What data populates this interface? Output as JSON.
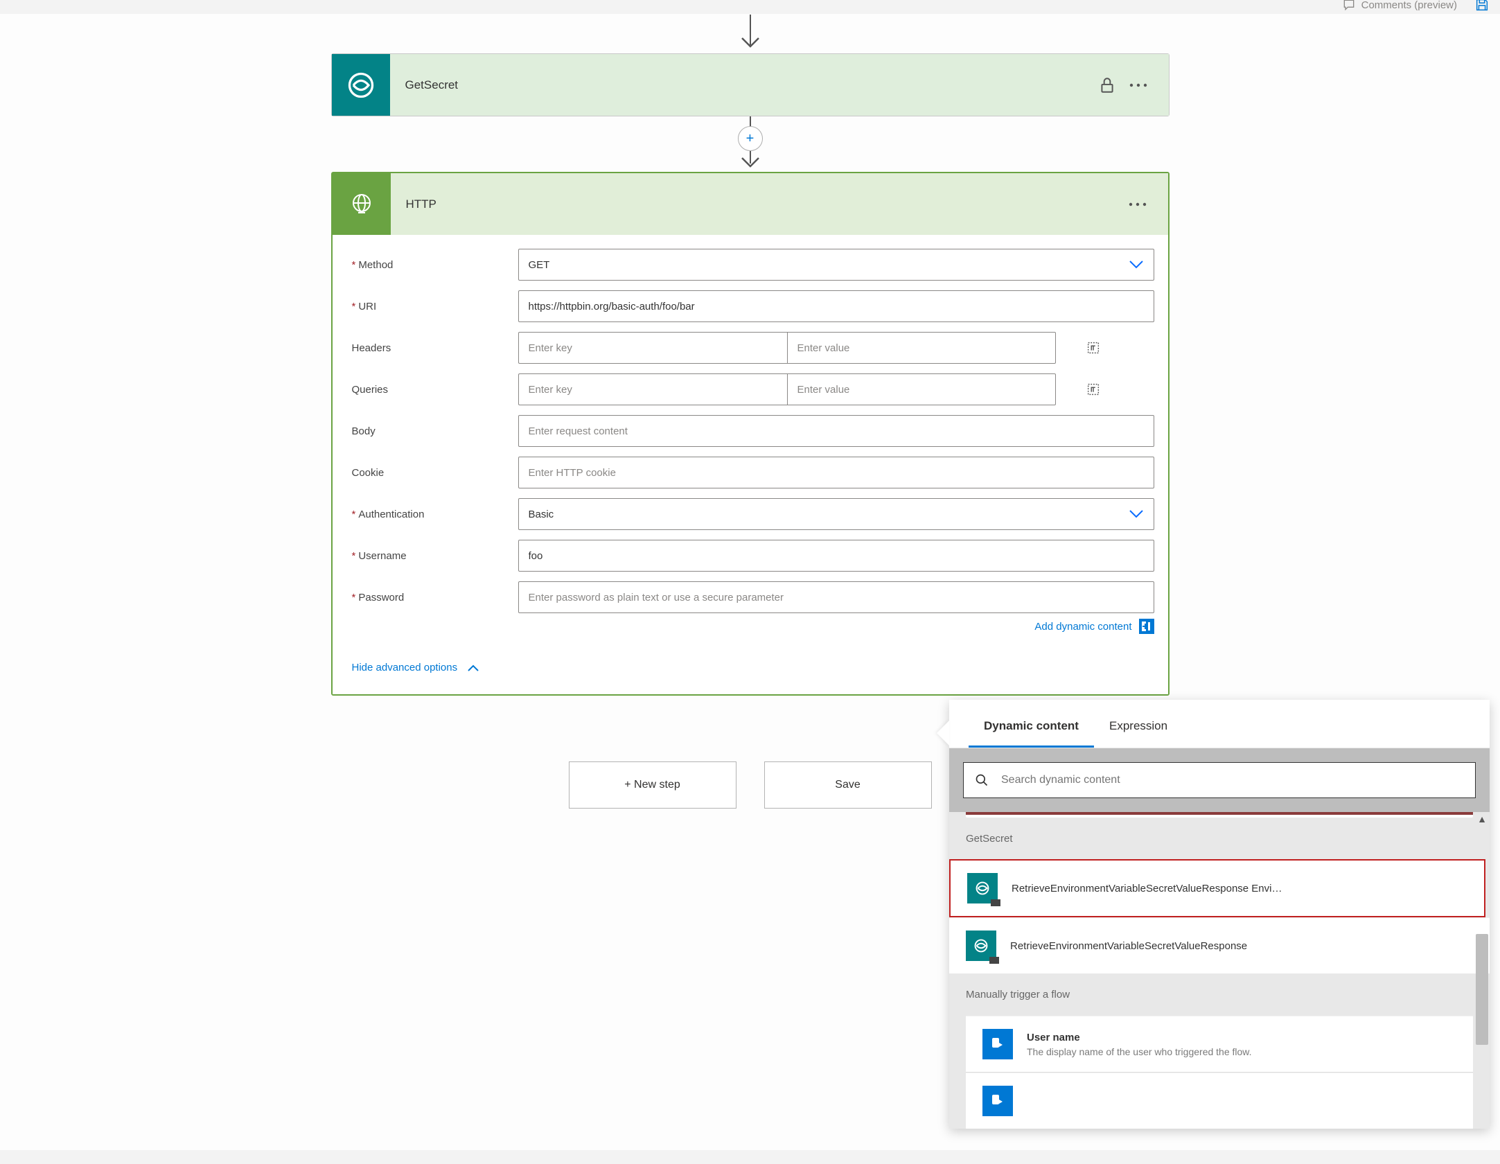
{
  "top": {
    "comments_label": "Comments (preview)"
  },
  "cards": {
    "getsecret": {
      "title": "GetSecret"
    },
    "http": {
      "title": "HTTP"
    }
  },
  "http": {
    "labels": {
      "method": "Method",
      "uri": "URI",
      "headers": "Headers",
      "queries": "Queries",
      "body": "Body",
      "cookie": "Cookie",
      "authentication": "Authentication",
      "username": "Username",
      "password": "Password"
    },
    "values": {
      "method": "GET",
      "uri": "https://httpbin.org/basic-auth/foo/bar",
      "authentication": "Basic",
      "username": "foo"
    },
    "placeholders": {
      "headers_key": "Enter key",
      "headers_value": "Enter value",
      "queries_key": "Enter key",
      "queries_value": "Enter value",
      "body": "Enter request content",
      "cookie": "Enter HTTP cookie",
      "password": "Enter password as plain text or use a secure parameter"
    },
    "add_dynamic": "Add dynamic content",
    "hide_advanced": "Hide advanced options"
  },
  "buttons": {
    "new_step": "+ New step",
    "save": "Save"
  },
  "dynamic": {
    "tabs": {
      "dynamic": "Dynamic content",
      "expression": "Expression"
    },
    "search_placeholder": "Search dynamic content",
    "sections": {
      "getsecret": "GetSecret",
      "manual": "Manually trigger a flow"
    },
    "items": {
      "retrieve_envi": "RetrieveEnvironmentVariableSecretValueResponse Envi…",
      "retrieve": "RetrieveEnvironmentVariableSecretValueResponse",
      "username_title": "User name",
      "username_desc": "The display name of the user who triggered the flow."
    }
  }
}
